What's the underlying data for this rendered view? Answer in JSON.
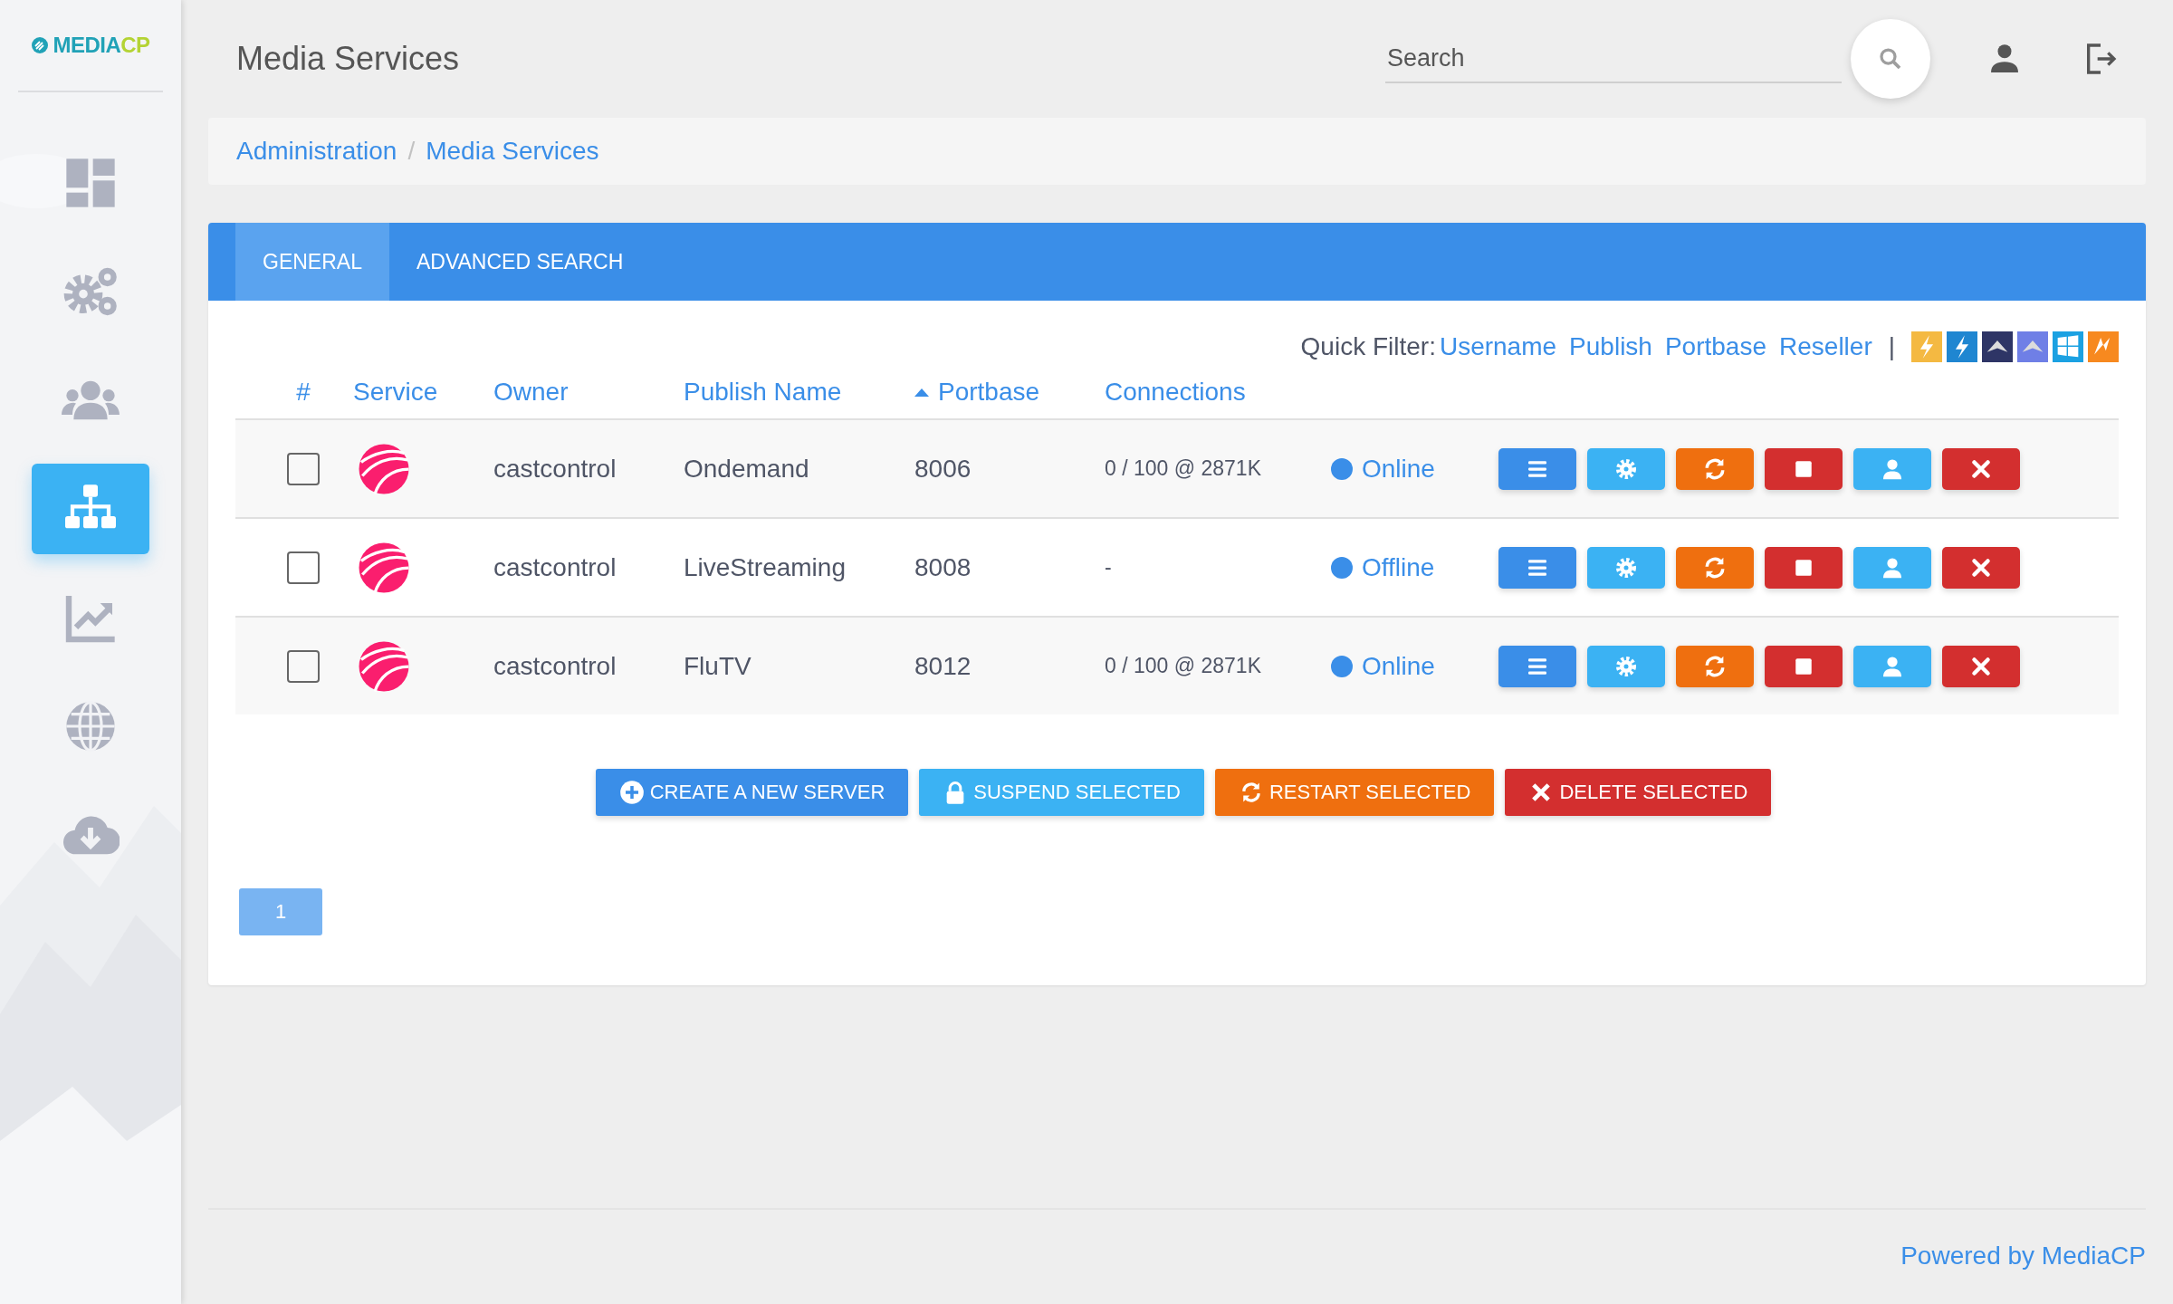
{
  "brand": {
    "name": "MEDIA",
    "suffix": "CP"
  },
  "sidebar": {
    "items": [
      {
        "kind": "dashboard",
        "selected": false
      },
      {
        "kind": "gears",
        "selected": false
      },
      {
        "kind": "users",
        "selected": false
      },
      {
        "kind": "sitemap",
        "selected": true
      },
      {
        "kind": "chart",
        "selected": false
      },
      {
        "kind": "globe",
        "selected": false
      },
      {
        "kind": "download",
        "selected": false
      }
    ]
  },
  "header": {
    "title": "Media Services",
    "search": {
      "placeholder": "Search"
    }
  },
  "breadcrumb": {
    "items": [
      "Administration",
      "Media Services"
    ],
    "separator": "/"
  },
  "tabs": [
    {
      "label": "GENERAL",
      "selected": true
    },
    {
      "label": "ADVANCED SEARCH",
      "selected": false
    }
  ],
  "quick_filter": {
    "label": "Quick Filter:",
    "links": [
      "Username",
      "Publish",
      "Portbase",
      "Reseller"
    ],
    "separator": "|",
    "icons": [
      {
        "kind": "shoutcast-yellow"
      },
      {
        "kind": "shoutcast-blue"
      },
      {
        "kind": "wings-dark"
      },
      {
        "kind": "wings-light"
      },
      {
        "kind": "windows"
      },
      {
        "kind": "wowza"
      }
    ]
  },
  "table": {
    "columns": [
      {
        "label": "#",
        "sorted": false
      },
      {
        "label": "Service",
        "sorted": false
      },
      {
        "label": "Owner",
        "sorted": false
      },
      {
        "label": "Publish Name",
        "sorted": false
      },
      {
        "label": "Portbase",
        "sorted": true
      },
      {
        "label": "Connections",
        "sorted": false
      }
    ],
    "rows": [
      {
        "checked": false,
        "owner": "castcontrol",
        "publish_name": "Ondemand",
        "portbase": "8006",
        "connections": "0 / 100 @ 2871K",
        "status": "Online"
      },
      {
        "checked": false,
        "owner": "castcontrol",
        "publish_name": "LiveStreaming",
        "portbase": "8008",
        "connections": "-",
        "status": "Offline"
      },
      {
        "checked": false,
        "owner": "castcontrol",
        "publish_name": "FluTV",
        "portbase": "8012",
        "connections": "0 / 100 @ 2871K",
        "status": "Online"
      }
    ],
    "row_actions": [
      {
        "kind": "menu"
      },
      {
        "kind": "settings"
      },
      {
        "kind": "restart"
      },
      {
        "kind": "stop"
      },
      {
        "kind": "user"
      },
      {
        "kind": "delete"
      }
    ]
  },
  "bulk_buttons": [
    {
      "kind": "create",
      "label": "CREATE A NEW SERVER"
    },
    {
      "kind": "suspend",
      "label": "SUSPEND SELECTED"
    },
    {
      "kind": "restart",
      "label": "RESTART SELECTED"
    },
    {
      "kind": "delete",
      "label": "DELETE SELECTED"
    }
  ],
  "pagination": [
    {
      "label": "1",
      "selected": true
    }
  ],
  "footer": {
    "text": "Powered by MediaCP"
  }
}
